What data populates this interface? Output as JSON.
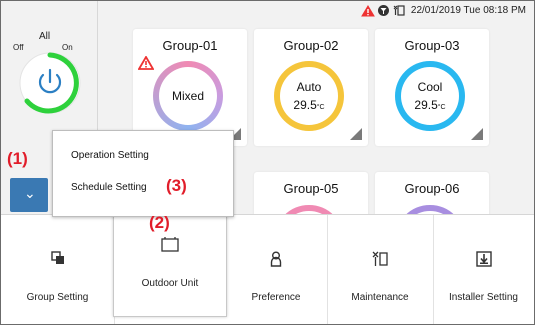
{
  "status_bar": {
    "datetime": "22/01/2019 Tue 08:18 PM",
    "icons": [
      "warning-icon",
      "filter-icon",
      "maintenance-icon"
    ]
  },
  "all_panel": {
    "title": "All",
    "off_label": "Off",
    "on_label": "On"
  },
  "groups": [
    {
      "name": "Group-01",
      "mode": "Mixed",
      "temp": "",
      "ring_color": "#f08ab3",
      "warning": true
    },
    {
      "name": "Group-02",
      "mode": "Auto",
      "temp": "29.5",
      "ring_color": "#f5c53b"
    },
    {
      "name": "Group-03",
      "mode": "Cool",
      "temp": "29.5",
      "ring_color": "#29b8f0"
    },
    {
      "name": "Group-05"
    },
    {
      "name": "Group-06"
    }
  ],
  "temp_unit": "°C",
  "popup_menu": {
    "items": [
      "Operation Setting",
      "Schedule Setting"
    ]
  },
  "callouts": [
    "(1)",
    "(2)",
    "(3)"
  ],
  "bottom_nav": [
    {
      "label": "Group Setting",
      "icon": "group-setting-icon"
    },
    {
      "label": "Outdoor Unit",
      "icon": "outdoor-unit-icon"
    },
    {
      "label": "Preference",
      "icon": "preference-icon"
    },
    {
      "label": "Maintenance",
      "icon": "maintenance-icon"
    },
    {
      "label": "Installer Setting",
      "icon": "installer-setting-icon"
    }
  ]
}
